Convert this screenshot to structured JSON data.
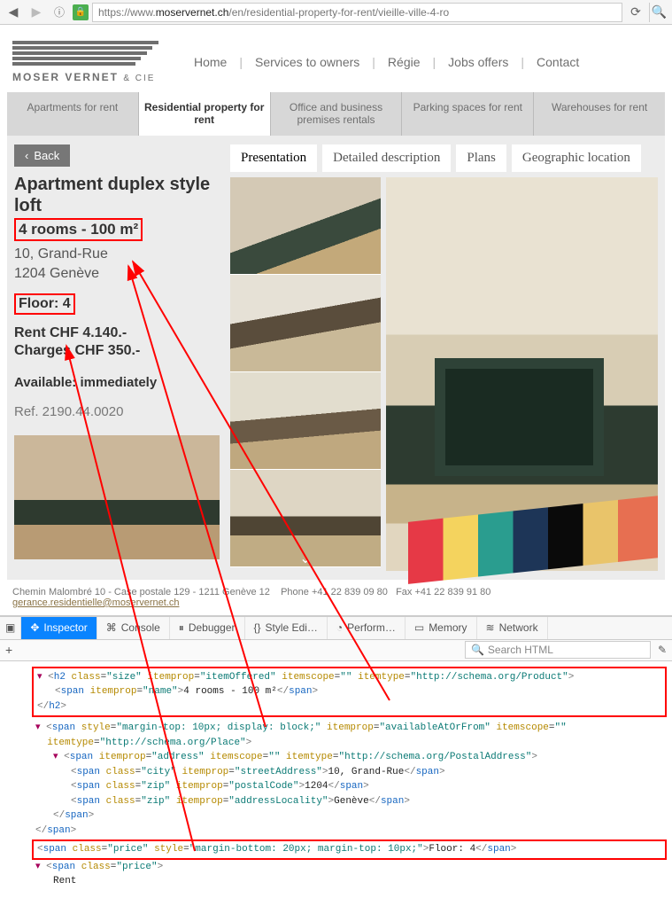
{
  "browser": {
    "url_prefix": "https://www.",
    "url_host": "moservernet.ch",
    "url_path": "/en/residential-property-for-rent/vieille-ville-4-ro"
  },
  "logo": {
    "line1": "MOSER VERNET",
    "line2": "& CIE"
  },
  "nav": {
    "home": "Home",
    "services": "Services to owners",
    "regie": "Régie",
    "jobs": "Jobs offers",
    "contact": "Contact"
  },
  "subnav": {
    "apartments": "Apartments for rent",
    "residential": "Residential property for rent",
    "office": "Office and business premises rentals",
    "parking": "Parking spaces for rent",
    "warehouses": "Warehouses for rent"
  },
  "back": "Back",
  "listing": {
    "title": "Apartment duplex style loft",
    "size": "4 rooms - 100 m²",
    "street": "10, Grand-Rue",
    "zip_city": "1204 Genève",
    "floor": "Floor: 4",
    "rent": "Rent CHF 4.140.-",
    "charges": "Charges CHF 350.-",
    "available": "Available: immediately",
    "ref": "Ref. 2190.44.0020"
  },
  "tabs2": {
    "presentation": "Presentation",
    "detailed": "Detailed description",
    "plans": "Plans",
    "geo": "Geographic location"
  },
  "footer": {
    "addr": "Chemin Malombré 10 - Case postale 129 - 1211 Genève 12",
    "phone": "Phone +41 22 839 09 80",
    "fax": "Fax +41 22 839 91 80",
    "email": "gerance.residentielle@moservernet.ch"
  },
  "devtools": {
    "tabs": {
      "inspector": "Inspector",
      "console": "Console",
      "debugger": "Debugger",
      "style": "Style Edi…",
      "perf": "Perform…",
      "memory": "Memory",
      "network": "Network"
    },
    "search_placeholder": "Search HTML",
    "code": {
      "l1a": "<h2 class=\"size\" itemprop=\"itemOffered\" itemscope=\"\" itemtype=\"http://schema.org/Product\">",
      "l1b": "  <span itemprop=\"name\">4 rooms - 100 m²</span>",
      "l1c": "</h2>",
      "l2": "<span style=\"margin-top: 10px; display: block;\" itemprop=\"availableAtOrFrom\" itemscope=\"\"",
      "l2b": "  itemtype=\"http://schema.org/Place\">",
      "l3": "<span itemprop=\"address\" itemscope=\"\" itemtype=\"http://schema.org/PostalAddress\">",
      "l4": "<span class=\"city\" itemprop=\"streetAddress\">10, Grand-Rue</span>",
      "l5": "<span class=\"zip\" itemprop=\"postalCode\">1204</span>",
      "l6": "<span class=\"zip\" itemprop=\"addressLocality\">Genève</span>",
      "l7": "</span>",
      "l8": "</span>",
      "l9": "<span class=\"price\" style=\"margin-bottom: 20px; margin-top: 10px;\">Floor: 4</span>",
      "l10": "<span class=\"price\">",
      "l11": "  Rent"
    }
  }
}
